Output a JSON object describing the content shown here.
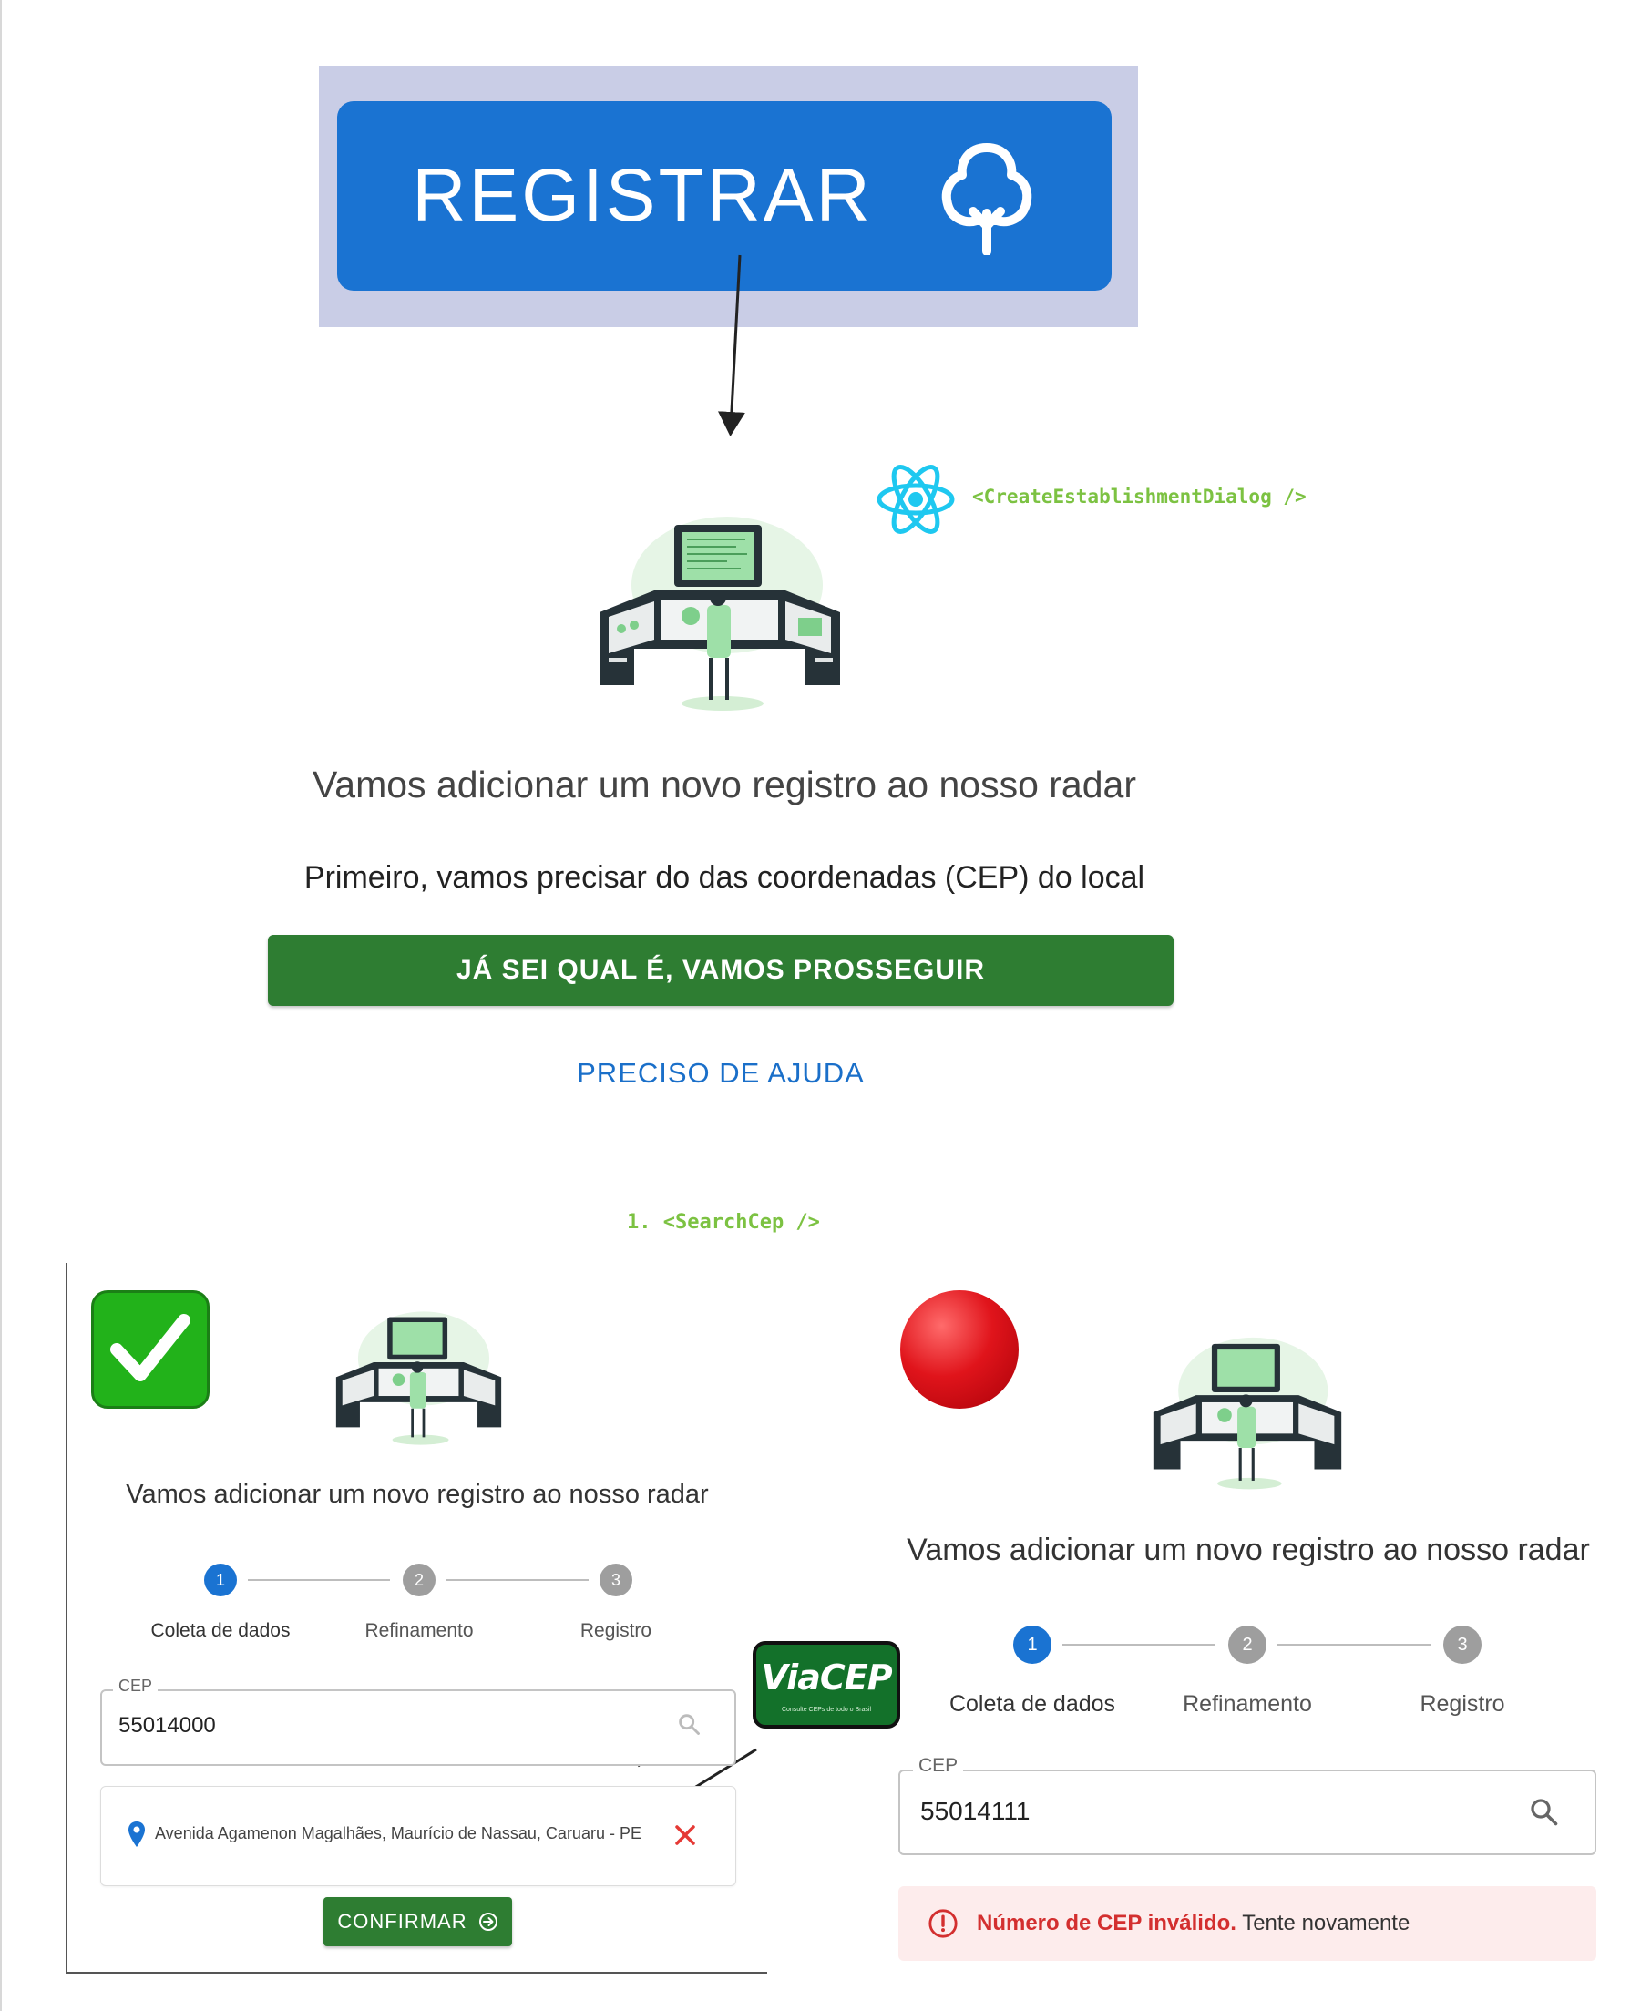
{
  "register_button": {
    "label": "REGISTRAR",
    "icon": "tree-icon"
  },
  "tags": {
    "create_dialog": "<CreateEstablishmentDialog />",
    "search_cep": "1. <SearchCep />"
  },
  "dialog": {
    "heading": "Vamos adicionar um novo registro ao nosso radar",
    "subheading": "Primeiro, vamos precisar do das coordenadas (CEP) do local",
    "proceed_button": "JÁ SEI QUAL É, VAMOS PROSSEGUIR",
    "help_link": "PRECISO DE AJUDA"
  },
  "steps": [
    {
      "number": "1",
      "label": "Coleta de dados",
      "active": true
    },
    {
      "number": "2",
      "label": "Refinamento",
      "active": false
    },
    {
      "number": "3",
      "label": "Registro",
      "active": false
    }
  ],
  "success_panel": {
    "status_icon": "check-mark-emoji",
    "heading": "Vamos adicionar um novo registro ao nosso radar",
    "cep_label": "CEP",
    "cep_value": "55014000",
    "address": "Avenida Agamenon Magalhães, Maurício de Nassau, Caruaru - PE",
    "confirm_button": "CONFIRMAR"
  },
  "error_panel": {
    "status_icon": "red-circle-emoji",
    "heading": "Vamos adicionar um novo registro ao nosso radar",
    "cep_label": "CEP",
    "cep_value": "55014111",
    "error_strong": "Número de CEP inválido.",
    "error_rest": "Tente novamente"
  },
  "viacep": {
    "logo": "ViaCEP",
    "tagline": "Consulte CEPs de todo o Brasil"
  },
  "colors": {
    "primary_blue": "#1a73d2",
    "green_button": "#2e7d32",
    "tag_green": "#7cc242",
    "error_red": "#d32f2f",
    "error_bg": "#fdecec"
  }
}
